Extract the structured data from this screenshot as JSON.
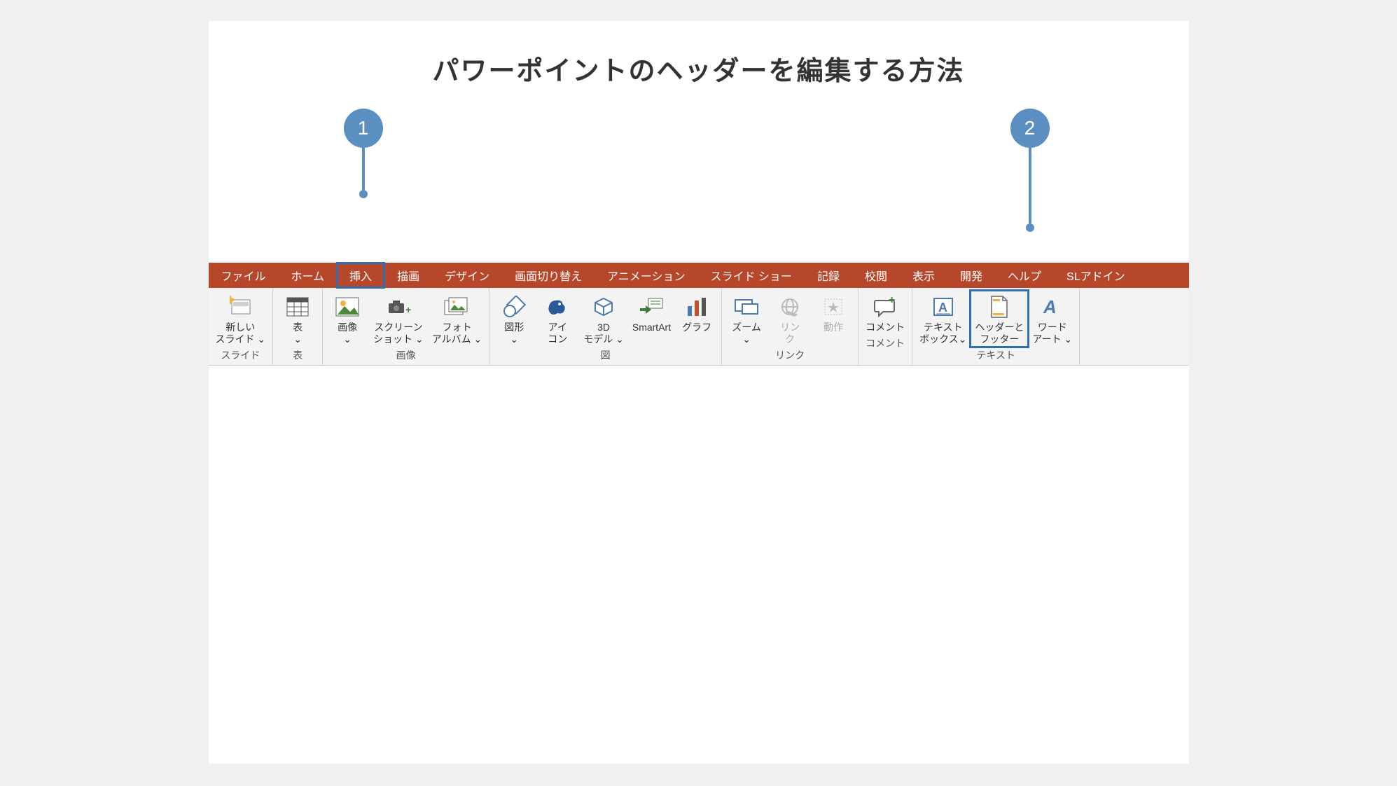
{
  "title": "パワーポイントのヘッダーを編集する方法",
  "callouts": {
    "c1": "1",
    "c2": "2"
  },
  "tabs": {
    "file": "ファイル",
    "home": "ホーム",
    "insert": "挿入",
    "draw": "描画",
    "design": "デザイン",
    "transitions": "画面切り替え",
    "animations": "アニメーション",
    "slideshow": "スライド ショー",
    "record": "記録",
    "review": "校閲",
    "view": "表示",
    "developer": "開発",
    "help": "ヘルプ",
    "addin": "SLアドイン"
  },
  "groups": {
    "slides": "スライド",
    "tables": "表",
    "images": "画像",
    "illustrations": "図",
    "links": "リンク",
    "comments": "コメント",
    "text": "テキスト"
  },
  "cmds": {
    "new_slide": "新しい\nスライド ⌄",
    "table": "表\n⌄",
    "pictures": "画像\n⌄",
    "screenshot": "スクリーン\nショット ⌄",
    "photo_album": "フォト\nアルバム ⌄",
    "shapes": "図形\n⌄",
    "icons": "アイ\nコン",
    "models3d": "3D\nモデル ⌄",
    "smartart": "SmartArt",
    "chart": "グラフ",
    "zoom": "ズーム\n⌄",
    "link": "リン\nク",
    "action": "動作",
    "comment": "コメント",
    "textbox": "テキスト\nボックス⌄",
    "header_footer": "ヘッダーと\nフッター",
    "wordart": "ワード\nアート ⌄"
  }
}
